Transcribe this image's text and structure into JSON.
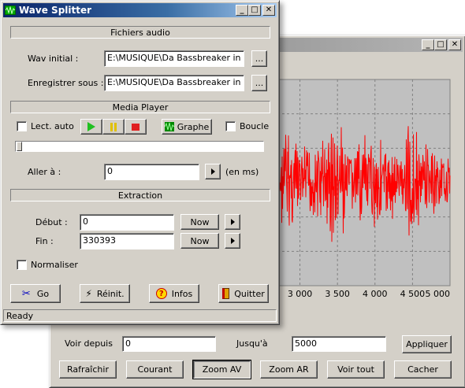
{
  "back_window": {
    "controls": {
      "voir_depuis_label": "Voir depuis",
      "voir_depuis_value": "0",
      "jusqua_label": "Jusqu'à",
      "jusqua_value": "5000",
      "appliquer": "Appliquer",
      "rafraichir": "Rafraîchir",
      "courant": "Courant",
      "zoom_av": "Zoom AV",
      "zoom_ar": "Zoom AR",
      "voir_tout": "Voir tout",
      "cacher": "Cacher"
    }
  },
  "chart_data": {
    "type": "line",
    "x_ticks": [
      "3 000",
      "3 500",
      "4 000",
      "4 500",
      "5 000"
    ],
    "x_tick_values": [
      3000,
      3500,
      4000,
      4500,
      5000
    ],
    "xlim": [
      2700,
      5000
    ],
    "grid": true,
    "series_color": "#ff0000",
    "envelope": {
      "x": [
        2700,
        2800,
        2850,
        2900,
        3000,
        3100,
        3200,
        3300,
        3350,
        3400,
        3450,
        3500,
        3550,
        3600,
        3700,
        3800,
        3900,
        4000,
        4050,
        4100,
        4200,
        4300,
        4400,
        4450,
        4500,
        4600,
        4700,
        4800,
        4900,
        5000
      ],
      "amplitude": [
        0.35,
        0.55,
        0.75,
        0.5,
        0.45,
        0.4,
        0.45,
        0.55,
        0.5,
        0.7,
        0.9,
        0.6,
        0.75,
        0.45,
        0.4,
        0.45,
        0.5,
        0.5,
        0.6,
        0.45,
        0.4,
        0.35,
        0.45,
        0.95,
        0.7,
        0.5,
        0.45,
        0.35,
        0.3,
        0.25
      ]
    }
  },
  "main_window": {
    "title": "Wave Splitter",
    "fichiers_audio": "Fichiers audio",
    "wav_initial_label": "Wav initial :",
    "wav_initial_value": "E:\\MUSIQUE\\Da Bassbreaker in d",
    "enregistrer_label": "Enregistrer sous :",
    "enregistrer_value": "E:\\MUSIQUE\\Da Bassbreaker in d",
    "browse": "...",
    "media_player": "Media Player",
    "lect_auto": "Lect. auto",
    "graphe": "Graphe",
    "boucle": "Boucle",
    "aller_label": "Aller à :",
    "aller_value": "0",
    "en_ms": "(en ms)",
    "extraction": "Extraction",
    "debut_label": "Début :",
    "debut_value": "0",
    "fin_label": "Fin :",
    "fin_value": "330393",
    "now": "Now",
    "normaliser": "Normaliser",
    "go": "Go",
    "reinit": "Réinit.",
    "infos": "Infos",
    "quitter": "Quitter",
    "status": "Ready"
  }
}
